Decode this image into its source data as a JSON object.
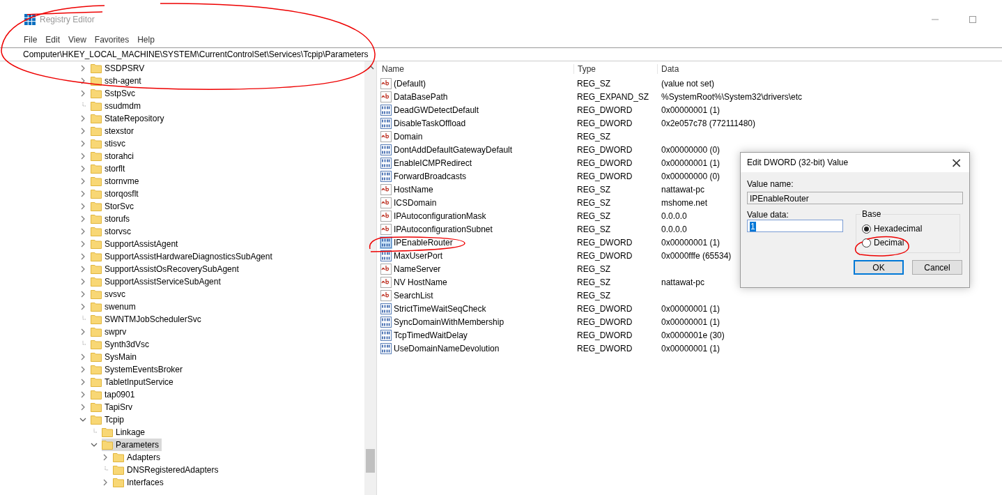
{
  "window": {
    "title": "Registry Editor"
  },
  "menu": [
    "File",
    "Edit",
    "View",
    "Favorites",
    "Help"
  ],
  "address": "Computer\\HKEY_LOCAL_MACHINE\\SYSTEM\\CurrentControlSet\\Services\\Tcpip\\Parameters",
  "tree": [
    {
      "label": "SSDPSRV",
      "expandable": true,
      "expanded": false,
      "selected": false
    },
    {
      "label": "ssh-agent",
      "expandable": true,
      "expanded": false,
      "selected": false
    },
    {
      "label": "SstpSvc",
      "expandable": true,
      "expanded": false,
      "selected": false
    },
    {
      "label": "ssudmdm",
      "expandable": false,
      "selected": false
    },
    {
      "label": "StateRepository",
      "expandable": true,
      "expanded": false,
      "selected": false
    },
    {
      "label": "stexstor",
      "expandable": true,
      "expanded": false,
      "selected": false
    },
    {
      "label": "stisvc",
      "expandable": true,
      "expanded": false,
      "selected": false
    },
    {
      "label": "storahci",
      "expandable": true,
      "expanded": false,
      "selected": false
    },
    {
      "label": "storflt",
      "expandable": true,
      "expanded": false,
      "selected": false
    },
    {
      "label": "stornvme",
      "expandable": true,
      "expanded": false,
      "selected": false
    },
    {
      "label": "storqosflt",
      "expandable": true,
      "expanded": false,
      "selected": false
    },
    {
      "label": "StorSvc",
      "expandable": true,
      "expanded": false,
      "selected": false
    },
    {
      "label": "storufs",
      "expandable": true,
      "expanded": false,
      "selected": false
    },
    {
      "label": "storvsc",
      "expandable": true,
      "expanded": false,
      "selected": false
    },
    {
      "label": "SupportAssistAgent",
      "expandable": true,
      "expanded": false,
      "selected": false
    },
    {
      "label": "SupportAssistHardwareDiagnosticsSubAgent",
      "expandable": true,
      "expanded": false,
      "selected": false
    },
    {
      "label": "SupportAssistOsRecoverySubAgent",
      "expandable": true,
      "expanded": false,
      "selected": false
    },
    {
      "label": "SupportAssistServiceSubAgent",
      "expandable": true,
      "expanded": false,
      "selected": false
    },
    {
      "label": "svsvc",
      "expandable": true,
      "expanded": false,
      "selected": false
    },
    {
      "label": "swenum",
      "expandable": true,
      "expanded": false,
      "selected": false
    },
    {
      "label": "SWNTMJobSchedulerSvc",
      "expandable": false,
      "selected": false
    },
    {
      "label": "swprv",
      "expandable": true,
      "expanded": false,
      "selected": false
    },
    {
      "label": "Synth3dVsc",
      "expandable": false,
      "selected": false
    },
    {
      "label": "SysMain",
      "expandable": true,
      "expanded": false,
      "selected": false
    },
    {
      "label": "SystemEventsBroker",
      "expandable": true,
      "expanded": false,
      "selected": false
    },
    {
      "label": "TabletInputService",
      "expandable": true,
      "expanded": false,
      "selected": false
    },
    {
      "label": "tap0901",
      "expandable": true,
      "expanded": false,
      "selected": false
    },
    {
      "label": "TapiSrv",
      "expandable": true,
      "expanded": false,
      "selected": false
    },
    {
      "label": "Tcpip",
      "expandable": true,
      "expanded": true,
      "selected": false,
      "children": [
        {
          "label": "Linkage",
          "expandable": false,
          "selected": false
        },
        {
          "label": "Parameters",
          "expandable": true,
          "expanded": true,
          "selected": true,
          "children": [
            {
              "label": "Adapters",
              "expandable": true,
              "expanded": false,
              "selected": false
            },
            {
              "label": "DNSRegisteredAdapters",
              "expandable": false,
              "selected": false
            },
            {
              "label": "Interfaces",
              "expandable": true,
              "expanded": false,
              "selected": false
            }
          ]
        }
      ]
    }
  ],
  "values": {
    "columns": [
      "Name",
      "Type",
      "Data"
    ],
    "rows": [
      {
        "kind": "string",
        "name": "(Default)",
        "type": "REG_SZ",
        "data": "(value not set)",
        "selected": false
      },
      {
        "kind": "string",
        "name": "DataBasePath",
        "type": "REG_EXPAND_SZ",
        "data": "%SystemRoot%\\System32\\drivers\\etc",
        "selected": false
      },
      {
        "kind": "binary",
        "name": "DeadGWDetectDefault",
        "type": "REG_DWORD",
        "data": "0x00000001 (1)",
        "selected": false
      },
      {
        "kind": "binary",
        "name": "DisableTaskOffload",
        "type": "REG_DWORD",
        "data": "0x2e057c78 (772111480)",
        "selected": false
      },
      {
        "kind": "string",
        "name": "Domain",
        "type": "REG_SZ",
        "selected": false
      },
      {
        "kind": "binary",
        "name": "DontAddDefaultGatewayDefault",
        "type": "REG_DWORD",
        "data": "0x00000000 (0)",
        "selected": false
      },
      {
        "kind": "binary",
        "name": "EnableICMPRedirect",
        "type": "REG_DWORD",
        "data": "0x00000001 (1)",
        "selected": false
      },
      {
        "kind": "binary",
        "name": "ForwardBroadcasts",
        "type": "REG_DWORD",
        "data": "0x00000000 (0)",
        "selected": false
      },
      {
        "kind": "string",
        "name": "HostName",
        "type": "REG_SZ",
        "data": "nattawat-pc",
        "selected": false
      },
      {
        "kind": "string",
        "name": "ICSDomain",
        "type": "REG_SZ",
        "data": "mshome.net",
        "selected": false
      },
      {
        "kind": "string",
        "name": "IPAutoconfigurationMask",
        "type": "REG_SZ",
        "data": "0.0.0.0",
        "selected": false
      },
      {
        "kind": "string",
        "name": "IPAutoconfigurationSubnet",
        "type": "REG_SZ",
        "data": "0.0.0.0",
        "selected": false
      },
      {
        "kind": "binary",
        "name": "IPEnableRouter",
        "type": "REG_DWORD",
        "data": "0x00000001 (1)",
        "selected": true
      },
      {
        "kind": "binary",
        "name": "MaxUserPort",
        "type": "REG_DWORD",
        "data": "0x0000fffe (65534)",
        "selected": false
      },
      {
        "kind": "string",
        "name": "NameServer",
        "type": "REG_SZ",
        "selected": false
      },
      {
        "kind": "string",
        "name": "NV HostName",
        "type": "REG_SZ",
        "data": "nattawat-pc",
        "selected": false
      },
      {
        "kind": "string",
        "name": "SearchList",
        "type": "REG_SZ",
        "selected": false
      },
      {
        "kind": "binary",
        "name": "StrictTimeWaitSeqCheck",
        "type": "REG_DWORD",
        "data": "0x00000001 (1)",
        "selected": false
      },
      {
        "kind": "binary",
        "name": "SyncDomainWithMembership",
        "type": "REG_DWORD",
        "data": "0x00000001 (1)",
        "selected": false
      },
      {
        "kind": "binary",
        "name": "TcpTimedWaitDelay",
        "type": "REG_DWORD",
        "data": "0x0000001e (30)",
        "selected": false
      },
      {
        "kind": "binary",
        "name": "UseDomainNameDevolution",
        "type": "REG_DWORD",
        "data": "0x00000001 (1)",
        "selected": false
      }
    ]
  },
  "dialog": {
    "title": "Edit DWORD (32-bit) Value",
    "close": "×",
    "value_name_label": "Value name:",
    "value_name": "IPEnableRouter",
    "value_data_label": "Value data:",
    "value_data": "1",
    "base_label": "Base",
    "base_options": [
      {
        "label": "Hexadecimal",
        "selected": true
      },
      {
        "label": "Decimal",
        "selected": false
      }
    ],
    "buttons": [
      {
        "label": "OK",
        "default": true
      },
      {
        "label": "Cancel",
        "default": false
      }
    ]
  }
}
